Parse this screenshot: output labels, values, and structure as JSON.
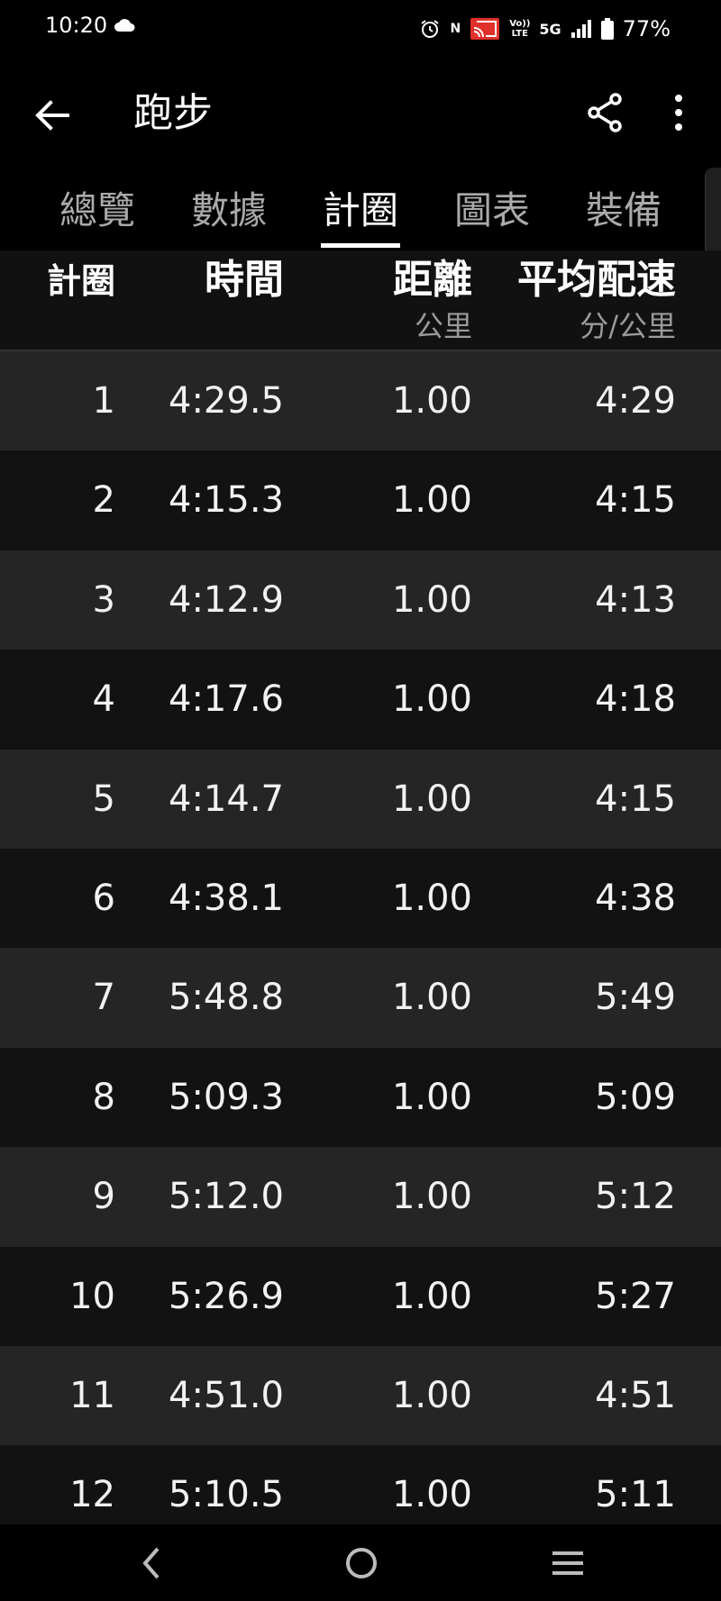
{
  "status_bar": {
    "time": "10:20",
    "network": "5G",
    "volte_top": "Vo))",
    "volte_bottom": "LTE",
    "nfc": "N",
    "battery": "77%"
  },
  "app_bar": {
    "title": "跑步"
  },
  "tabs": [
    {
      "label": "總覽",
      "active": false
    },
    {
      "label": "數據",
      "active": false
    },
    {
      "label": "計圈",
      "active": true
    },
    {
      "label": "圖表",
      "active": false
    },
    {
      "label": "裝備",
      "active": false
    }
  ],
  "table": {
    "headers": {
      "lap": "計圈",
      "time": "時間",
      "distance": "距離",
      "distance_unit": "公里",
      "pace": "平均配速",
      "pace_unit": "分/公里"
    },
    "rows": [
      {
        "lap": "1",
        "time": "4:29.5",
        "distance": "1.00",
        "pace": "4:29"
      },
      {
        "lap": "2",
        "time": "4:15.3",
        "distance": "1.00",
        "pace": "4:15"
      },
      {
        "lap": "3",
        "time": "4:12.9",
        "distance": "1.00",
        "pace": "4:13"
      },
      {
        "lap": "4",
        "time": "4:17.6",
        "distance": "1.00",
        "pace": "4:18"
      },
      {
        "lap": "5",
        "time": "4:14.7",
        "distance": "1.00",
        "pace": "4:15"
      },
      {
        "lap": "6",
        "time": "4:38.1",
        "distance": "1.00",
        "pace": "4:38"
      },
      {
        "lap": "7",
        "time": "5:48.8",
        "distance": "1.00",
        "pace": "5:49"
      },
      {
        "lap": "8",
        "time": "5:09.3",
        "distance": "1.00",
        "pace": "5:09"
      },
      {
        "lap": "9",
        "time": "5:12.0",
        "distance": "1.00",
        "pace": "5:12"
      },
      {
        "lap": "10",
        "time": "5:26.9",
        "distance": "1.00",
        "pace": "5:27"
      },
      {
        "lap": "11",
        "time": "4:51.0",
        "distance": "1.00",
        "pace": "4:51"
      },
      {
        "lap": "12",
        "time": "5:10.5",
        "distance": "1.00",
        "pace": "5:11"
      }
    ]
  }
}
